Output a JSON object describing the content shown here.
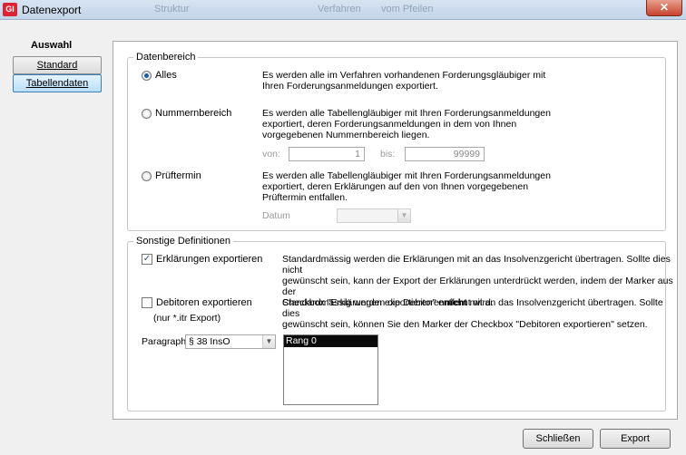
{
  "window": {
    "title": "Datenexport",
    "app_icon": "GI",
    "ghost_titles": [
      "Struktur",
      "Verfahren",
      "vom Pfeilen"
    ],
    "close_label": "✕"
  },
  "sidebar": {
    "title": "Auswahl",
    "buttons": [
      {
        "label": "Standard",
        "active": false
      },
      {
        "label": "Tabellendaten",
        "active": true
      }
    ]
  },
  "datenbereich": {
    "legend": "Datenbereich",
    "options": [
      {
        "label": "Alles",
        "checked": true,
        "desc": [
          "Es werden alle im Verfahren vorhandenen Forderungsgläubiger mit",
          "Ihren Forderungsanmeldungen exportiert."
        ]
      },
      {
        "label": "Nummernbereich",
        "checked": false,
        "desc": [
          "Es werden alle Tabellengläubiger mit Ihren Forderungsanmeldungen",
          "exportiert, deren Forderungsanmeldungen in dem von Ihnen",
          "vorgegebenen Nummernbereich liegen."
        ]
      },
      {
        "label": "Prüftermin",
        "checked": false,
        "desc": [
          "Es werden alle Tabellengläubiger mit Ihren Forderungsanmeldungen",
          "exportiert, deren Erklärungen auf den von Ihnen vorgegebenen",
          "Prüftermin entfallen."
        ]
      }
    ],
    "von_label": "von:",
    "von_value": "1",
    "bis_label": "bis:",
    "bis_value": "99999",
    "datum_label": "Datum",
    "datum_arrow": "▼"
  },
  "sonstige": {
    "legend": "Sonstige Definitionen",
    "erklaerungen": {
      "label": "Erklärungen exportieren",
      "checked": true,
      "check_mark": "✓",
      "desc": [
        "Standardmässig werden die Erklärungen mit an das Insolvenzgericht übertragen. Sollte dies nicht",
        "gewünscht sein, kann der Export der Erklärungen unterdrückt werden, indem der Marker aus der",
        "Checkbox \"Erklärungen exportieren\" entfernt wird."
      ]
    },
    "debitoren": {
      "label": "Debitoren exportieren",
      "sublabel": "(nur *.itr Export)",
      "checked": false,
      "desc_pre": "Standardmässig werden die Debitoren",
      "desc_bold": "nicht",
      "desc_post": " mit an das Insolvenzgericht übertragen. Sollte dies",
      "desc_line2": "gewünscht sein, können Sie den Marker der Checkbox \"Debitoren exportieren\" setzen."
    },
    "paragraph_label": "Paragraph",
    "paragraph_value": "§ 38 InsO",
    "paragraph_arrow": "▼",
    "rang_items": [
      "Rang 0"
    ]
  },
  "footer": {
    "close_label": "Schließen",
    "export_label": "Export"
  }
}
